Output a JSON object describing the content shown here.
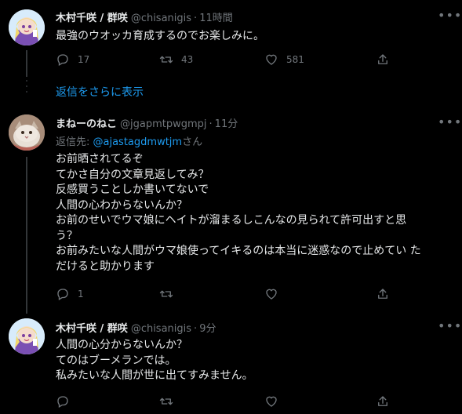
{
  "tweets": [
    {
      "name": "木村千咲 / 群咲",
      "handle": "@chisanigis",
      "time": "11時間",
      "text": [
        "最強のウオッカ育成するのでお楽しみに。"
      ],
      "reply_count": "17",
      "retweet_count": "43",
      "like_count": "581"
    },
    {
      "name": "まねーのねこ",
      "handle": "@jgapmtpwgmpj",
      "time": "11分",
      "reply_prefix": "返信先: ",
      "reply_mention": "@ajastagdmwtjm",
      "reply_suffix": "さん",
      "text": [
        "お前晒されてるぞ",
        "てかさ自分の文章見返してみ？",
        "反感買うことしか書いてないで",
        "人間の心わからないんか？",
        "お前のせいでウマ娘にヘイトが溜まるしこんなの見られて許可出すと思",
        "う？",
        "お前みたいな人間がウマ娘使ってイキるのは本当に迷惑なので止めてい た",
        "だけると助かります"
      ],
      "reply_count": "1"
    },
    {
      "name": "木村千咲 / 群咲",
      "handle": "@chisanigis",
      "time": "9分",
      "text": [
        "人間の心分からないんか？",
        "てのはブーメランでは。",
        "私みたいな人間が世に出てすみません。"
      ]
    }
  ],
  "show_more_replies": "返信をさらに表示",
  "icons": {
    "reply": "reply-icon",
    "retweet": "retweet-icon",
    "like": "heart-icon",
    "share": "share-icon",
    "more": "more-icon"
  },
  "colors": {
    "background": "#000000",
    "text": "#e7e9ea",
    "muted": "#71767b",
    "link": "#1d9bf0"
  }
}
